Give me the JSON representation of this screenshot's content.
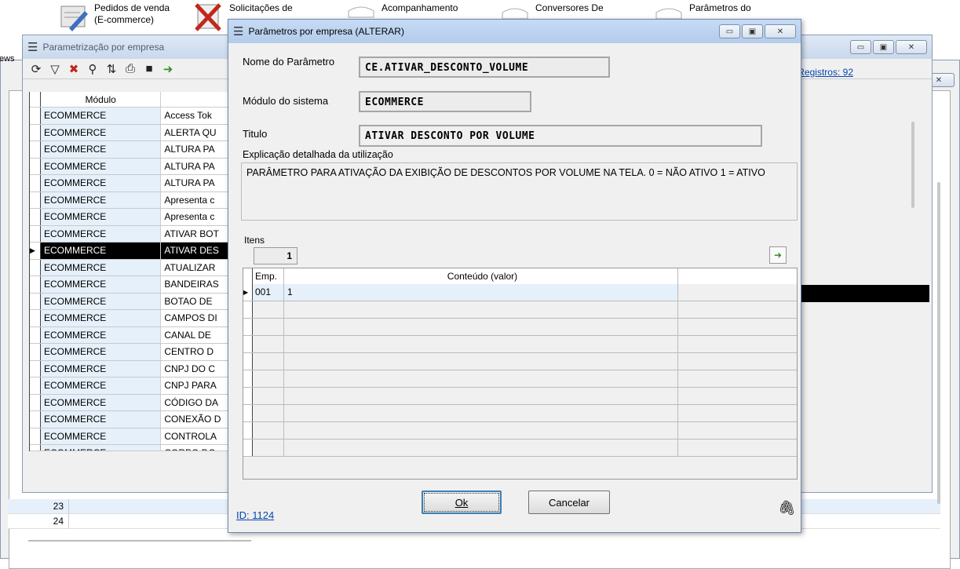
{
  "launcher": [
    {
      "label1": "Pedidos de venda",
      "label2": "(E-commerce)"
    },
    {
      "label1": "Solicitações de",
      "label2": ""
    },
    {
      "label1": "Acompanhamento",
      "label2": ""
    },
    {
      "label1": "Conversores De",
      "label2": ""
    },
    {
      "label1": "Parâmetros do",
      "label2": ""
    }
  ],
  "back_window": {
    "partial_label": "ews"
  },
  "param_window": {
    "title": "Parametrização por empresa",
    "registros": "Registros: 92",
    "grid_header": {
      "modulo": "Módulo"
    },
    "rows": [
      {
        "modulo": "ECOMMERCE",
        "desc": "Access Tok"
      },
      {
        "modulo": "ECOMMERCE",
        "desc": "ALERTA QU"
      },
      {
        "modulo": "ECOMMERCE",
        "desc": "ALTURA PA"
      },
      {
        "modulo": "ECOMMERCE",
        "desc": "ALTURA PA"
      },
      {
        "modulo": "ECOMMERCE",
        "desc": "ALTURA PA"
      },
      {
        "modulo": "ECOMMERCE",
        "desc": "Apresenta c"
      },
      {
        "modulo": "ECOMMERCE",
        "desc": "Apresenta c"
      },
      {
        "modulo": "ECOMMERCE",
        "desc": "ATIVAR BOT"
      },
      {
        "modulo": "ECOMMERCE",
        "desc": "ATIVAR DES"
      },
      {
        "modulo": "ECOMMERCE",
        "desc": "ATUALIZAR"
      },
      {
        "modulo": "ECOMMERCE",
        "desc": "BANDEIRAS"
      },
      {
        "modulo": "ECOMMERCE",
        "desc": "BOTAO DE"
      },
      {
        "modulo": "ECOMMERCE",
        "desc": "CAMPOS DI"
      },
      {
        "modulo": "ECOMMERCE",
        "desc": "CANAL DE"
      },
      {
        "modulo": "ECOMMERCE",
        "desc": "CENTRO D"
      },
      {
        "modulo": "ECOMMERCE",
        "desc": "CNPJ DO C"
      },
      {
        "modulo": "ECOMMERCE",
        "desc": "CNPJ PARA"
      },
      {
        "modulo": "ECOMMERCE",
        "desc": "CÓDIGO DA"
      },
      {
        "modulo": "ECOMMERCE",
        "desc": "CONEXÃO D"
      },
      {
        "modulo": "ECOMMERCE",
        "desc": "CONTROLA"
      },
      {
        "modulo": "ECOMMERCE",
        "desc": "CORPO DO"
      }
    ],
    "bottom_rows": [
      "23",
      "24"
    ]
  },
  "dialog": {
    "title": "Parâmetros por empresa (ALTERAR)",
    "nome_label": "Nome do Parâmetro",
    "nome_value": "CE.ATIVAR_DESCONTO_VOLUME",
    "modulo_label": "Módulo do sistema",
    "modulo_value": "ECOMMERCE",
    "titulo_label": "Titulo",
    "titulo_value": "ATIVAR DESCONTO POR VOLUME",
    "explicacao_label": "Explicação detalhada da utilização",
    "explicacao_text": "PARÂMETRO PARA ATIVAÇÃO DA EXIBIÇÃO DE DESCONTOS POR VOLUME NA TELA. 0 = NÃO ATIVO 1 = ATIVO",
    "itens_label": "Itens",
    "itens_count": "1",
    "grid_header": {
      "emp": "Emp.",
      "conteudo": "Conteúdo (valor)"
    },
    "grid_rows": [
      {
        "emp": "001",
        "conteudo": "1"
      }
    ],
    "ok_label": "Ok",
    "cancel_label": "Cancelar",
    "id_label": "ID: 1124"
  }
}
